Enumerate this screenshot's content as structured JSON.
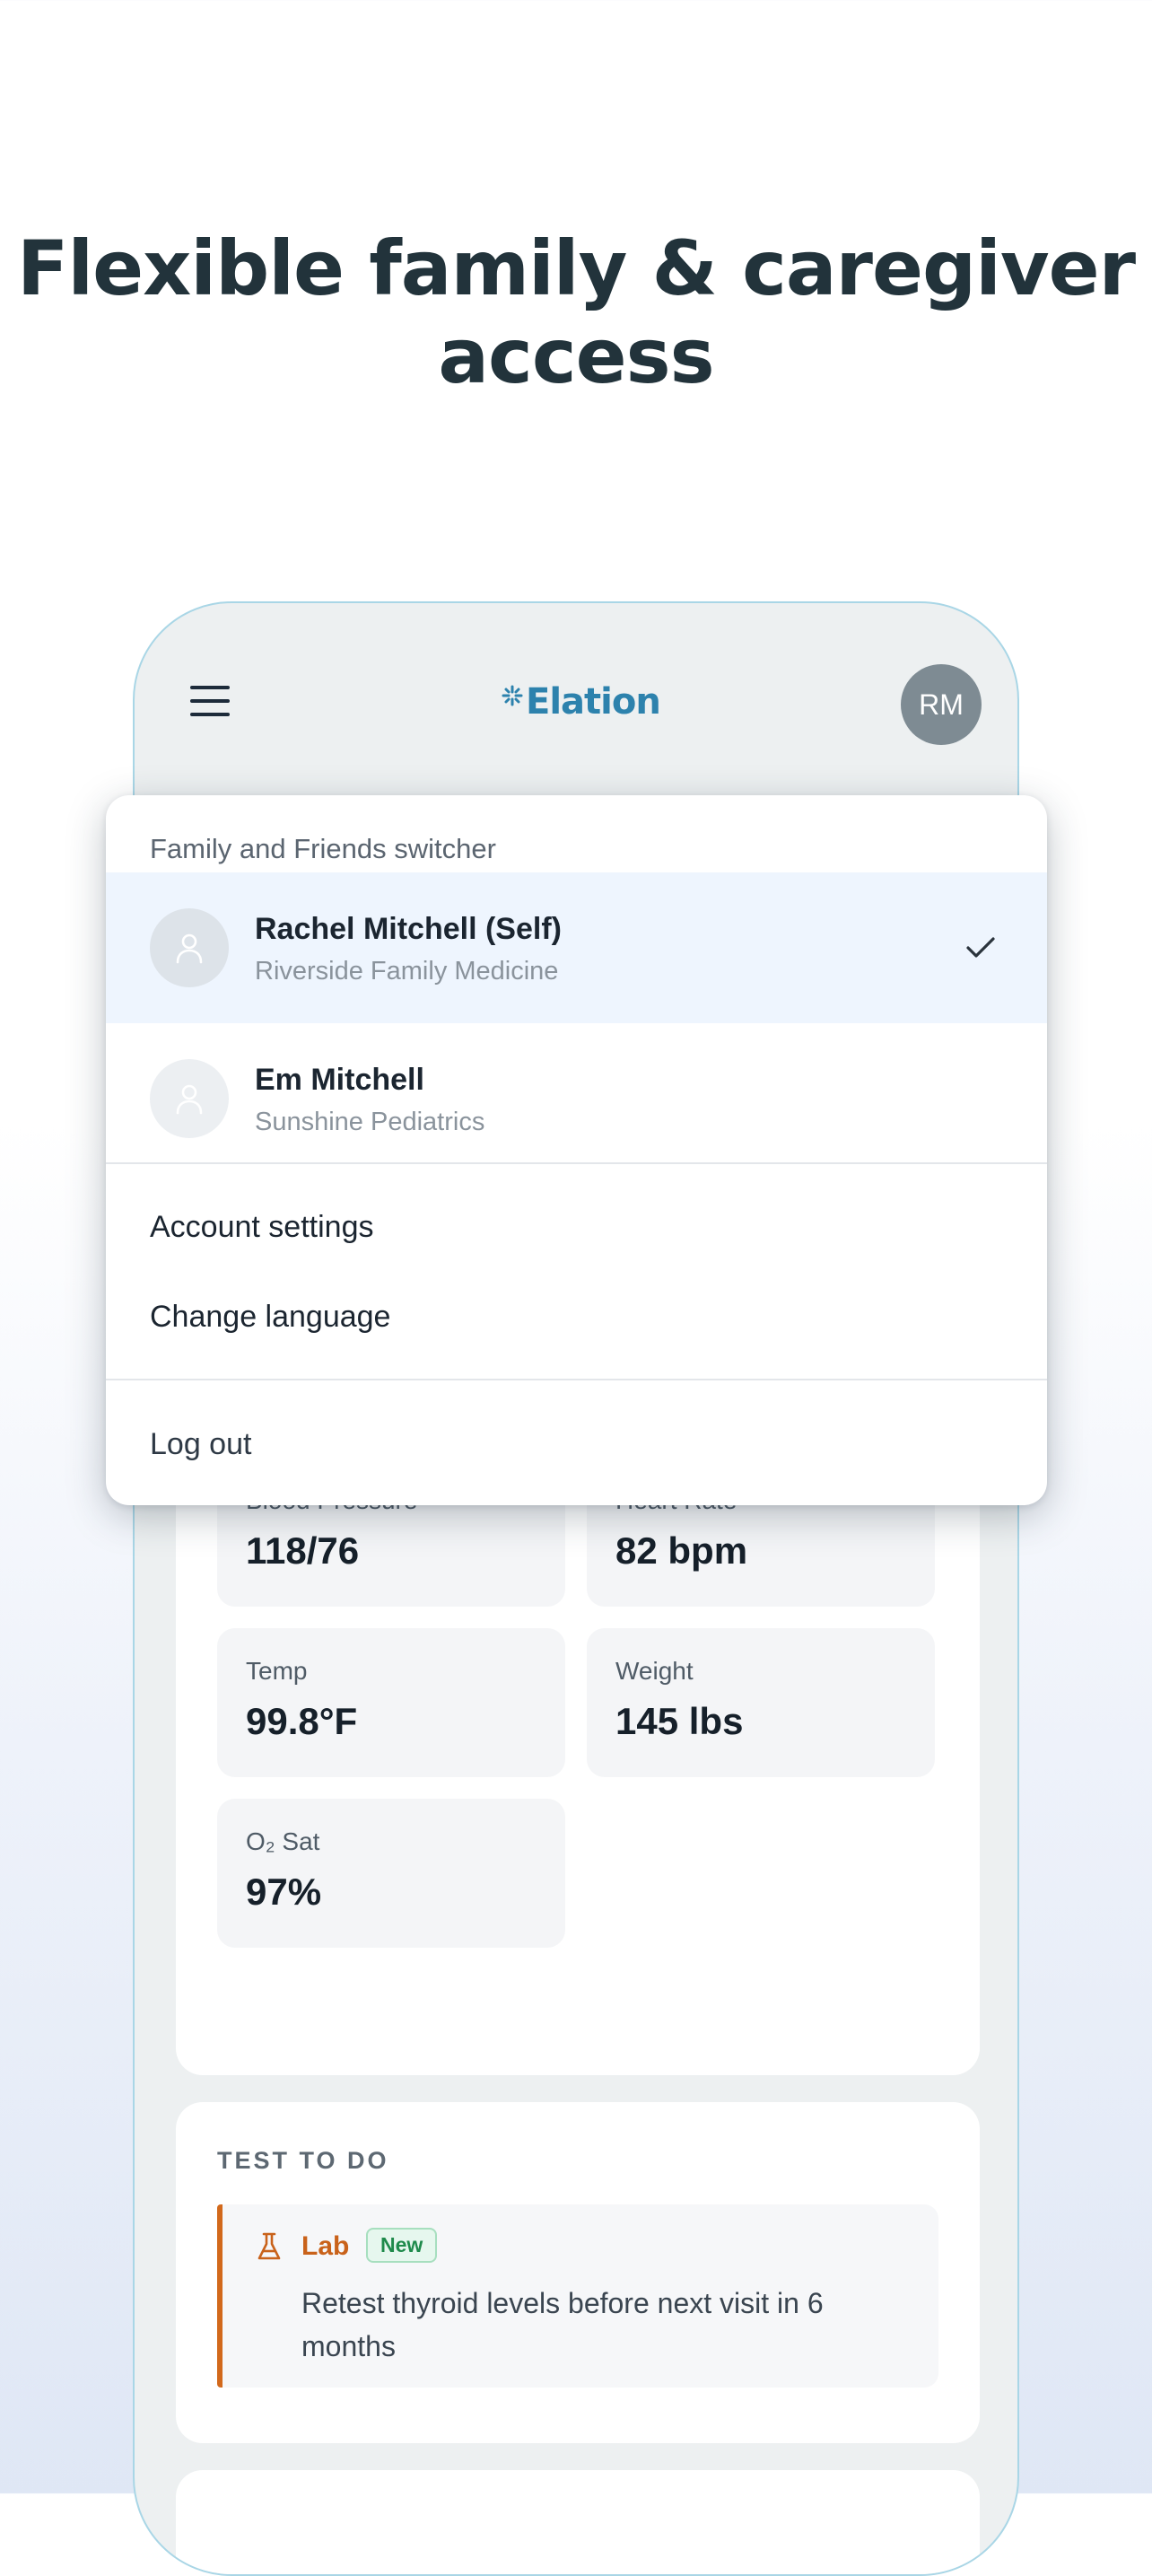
{
  "headline": {
    "line1": "Flexible family & caregiver",
    "line2": "access"
  },
  "app": {
    "logo_text": "Elation",
    "avatar_initials": "RM",
    "brand_color": "#2d82ad",
    "icons": {
      "menu": "hamburger-icon",
      "logo": "sparkle-icon"
    }
  },
  "dropdown": {
    "header": "Family and Friends switcher",
    "people": [
      {
        "name": "Rachel Mitchell (Self)",
        "practice": "Riverside Family Medicine",
        "selected": true
      },
      {
        "name": "Em Mitchell",
        "practice": "Sunshine Pediatrics",
        "selected": false
      }
    ],
    "menu": {
      "account_settings": "Account settings",
      "change_language": "Change language",
      "log_out": "Log out"
    },
    "icons": {
      "person": "person-icon",
      "check": "check-icon"
    }
  },
  "vitals": {
    "items": [
      {
        "label": "Blood Pressure",
        "value": "118/76"
      },
      {
        "label": "Heart Rate",
        "value": "82 bpm"
      },
      {
        "label": "Temp",
        "value": "99.8°F"
      },
      {
        "label": "Weight",
        "value": "145 lbs"
      },
      {
        "label": "O₂ Sat",
        "value": "97%"
      }
    ]
  },
  "tests": {
    "title": "TEST TO DO",
    "item": {
      "type": "Lab",
      "badge": "New",
      "description": "Retest thyroid levels before next visit in 6 months",
      "accent_color": "#d2691c",
      "icon": "flask-icon"
    }
  }
}
